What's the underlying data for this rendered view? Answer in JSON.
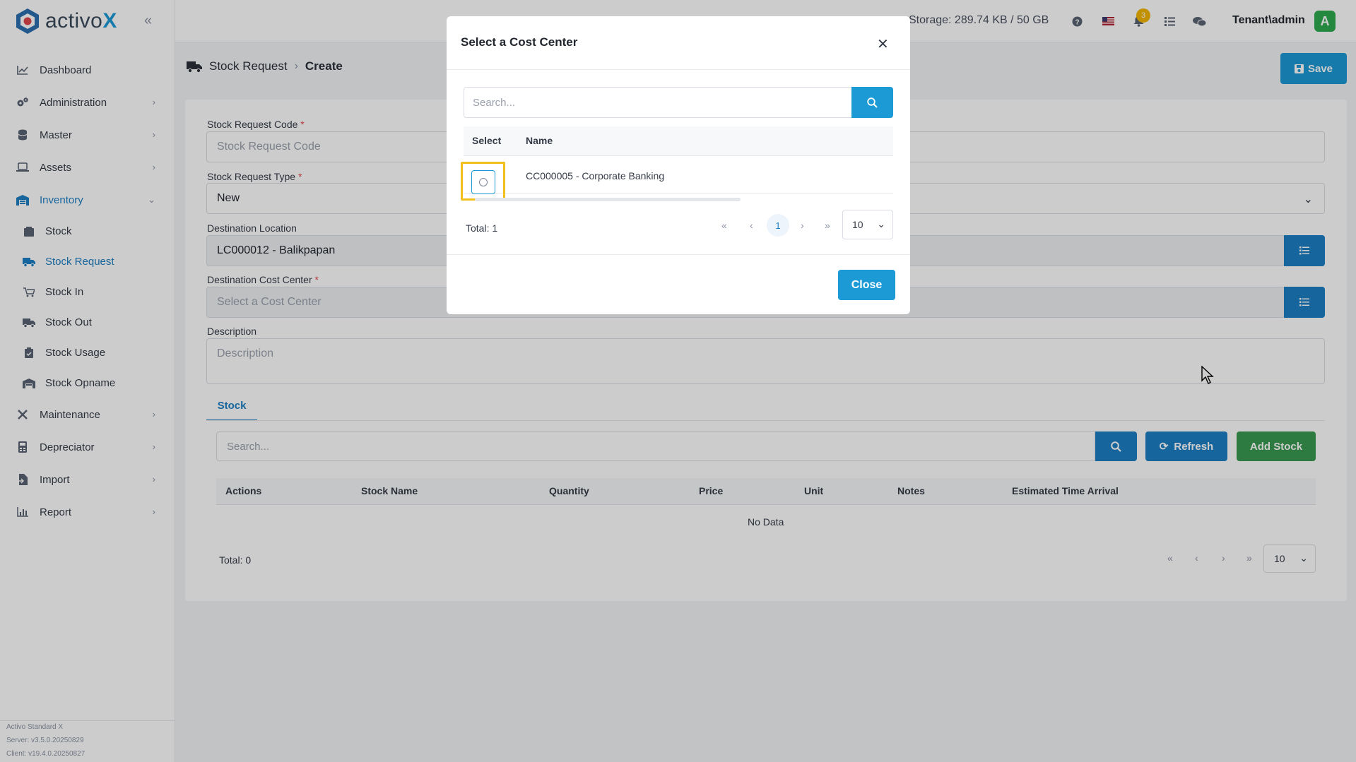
{
  "app": {
    "logo_text": "activo",
    "logo_x": "X"
  },
  "sidebar": {
    "items": [
      {
        "label": "Dashboard",
        "icon": "chart-icon"
      },
      {
        "label": "Administration",
        "icon": "gears-icon"
      },
      {
        "label": "Master",
        "icon": "database-icon"
      },
      {
        "label": "Assets",
        "icon": "laptop-icon"
      },
      {
        "label": "Inventory",
        "icon": "warehouse-icon"
      }
    ],
    "inventory_sub": [
      {
        "label": "Stock"
      },
      {
        "label": "Stock Request"
      },
      {
        "label": "Stock In"
      },
      {
        "label": "Stock Out"
      },
      {
        "label": "Stock Usage"
      },
      {
        "label": "Stock Opname"
      }
    ],
    "items_after": [
      {
        "label": "Maintenance"
      },
      {
        "label": "Depreciator"
      },
      {
        "label": "Import"
      },
      {
        "label": "Report"
      }
    ],
    "version": {
      "product": "Activo Standard X",
      "server": "Server: v3.5.0.20250829",
      "client": "Client: v19.4.0.20250827"
    }
  },
  "topbar": {
    "storage": "Storage: 289.74 KB / 50 GB",
    "notif_count": "3",
    "user": "Tenant\\admin",
    "avatar_letter": "A"
  },
  "page": {
    "breadcrumb_parent": "Stock Request",
    "breadcrumb_current": "Create",
    "save_label": "Save"
  },
  "form": {
    "code_label": "Stock Request Code",
    "code_placeholder": "Stock Request Code",
    "type_label": "Stock Request Type",
    "type_value": "New",
    "dest_location_label": "Destination Location",
    "dest_location_value": "LC000012 - Balikpapan",
    "dest_cost_center_label": "Destination Cost Center",
    "dest_cost_center_placeholder": "Select a Cost Center",
    "description_label": "Description",
    "description_placeholder": "Description",
    "required_mark": "*"
  },
  "stock_tab": {
    "tab_label": "Stock",
    "search_placeholder": "Search...",
    "refresh_label": "Refresh",
    "add_label": "Add Stock",
    "columns": [
      "Actions",
      "Stock Name",
      "Quantity",
      "Price",
      "Unit",
      "Notes",
      "Estimated Time Arrival"
    ],
    "empty_text": "No Data",
    "total": "Total: 0",
    "page_size": "10"
  },
  "modal": {
    "title": "Select a Cost Center",
    "search_placeholder": "Search...",
    "columns": [
      "Select",
      "Name"
    ],
    "rows": [
      {
        "name": "CC000005 - Corporate Banking"
      }
    ],
    "total": "Total: 1",
    "current_page": "1",
    "page_size": "10",
    "close_label": "Close"
  },
  "colors": {
    "primary": "#1c9ad6",
    "success": "#3a9a52",
    "highlight": "#f2c01c"
  }
}
